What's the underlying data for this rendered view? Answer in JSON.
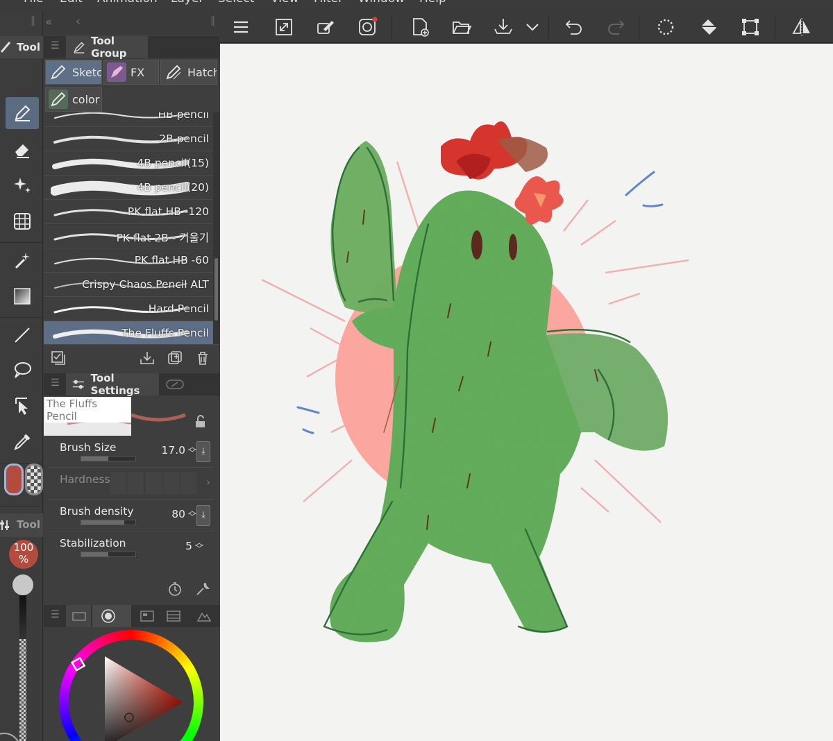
{
  "menu": [
    "File",
    "Edit",
    "Animation",
    "Layer",
    "Select",
    "View",
    "Filter",
    "Window",
    "Help"
  ],
  "tool_strip": {
    "title": "Tool",
    "sub_title": "Tool",
    "opacity_value": "100",
    "opacity_unit": "%"
  },
  "tool_group_panel": {
    "tab_tool": "Tool",
    "tab_group": "Tool Group",
    "groups": [
      "Sketch",
      "FX",
      "Hatch",
      "color pencils"
    ]
  },
  "brushes": [
    {
      "name": "HB pencil"
    },
    {
      "name": "2B pencil"
    },
    {
      "name": "4B pencil(15)"
    },
    {
      "name": "4B pencil(20)"
    },
    {
      "name": "PK flat HB -120"
    },
    {
      "name": "PK flat 2B - 기울기"
    },
    {
      "name": "PK flat HB -60"
    },
    {
      "name": "Crispy Chaos Pencil ALT"
    },
    {
      "name": "Hard Pencil"
    },
    {
      "name": "The Fluffs Pencil",
      "selected": true
    }
  ],
  "tool_settings": {
    "title": "Tool Settings",
    "brush_name": "The Fluffs Pencil",
    "brush_size_label": "Brush Size",
    "brush_size_value": "17.0",
    "brush_size_fill": 0.5,
    "hardness_label": "Hardness",
    "brush_density_label": "Brush density",
    "brush_density_value": "80",
    "brush_density_fill": 0.8,
    "stabilization_label": "Stabilization",
    "stabilization_value": "5",
    "stabilization_fill": 0.5
  },
  "colors": {
    "main_color": "#b24c3f",
    "accent": "#5d6e86",
    "canvas_bg": "#f3f3f2"
  }
}
